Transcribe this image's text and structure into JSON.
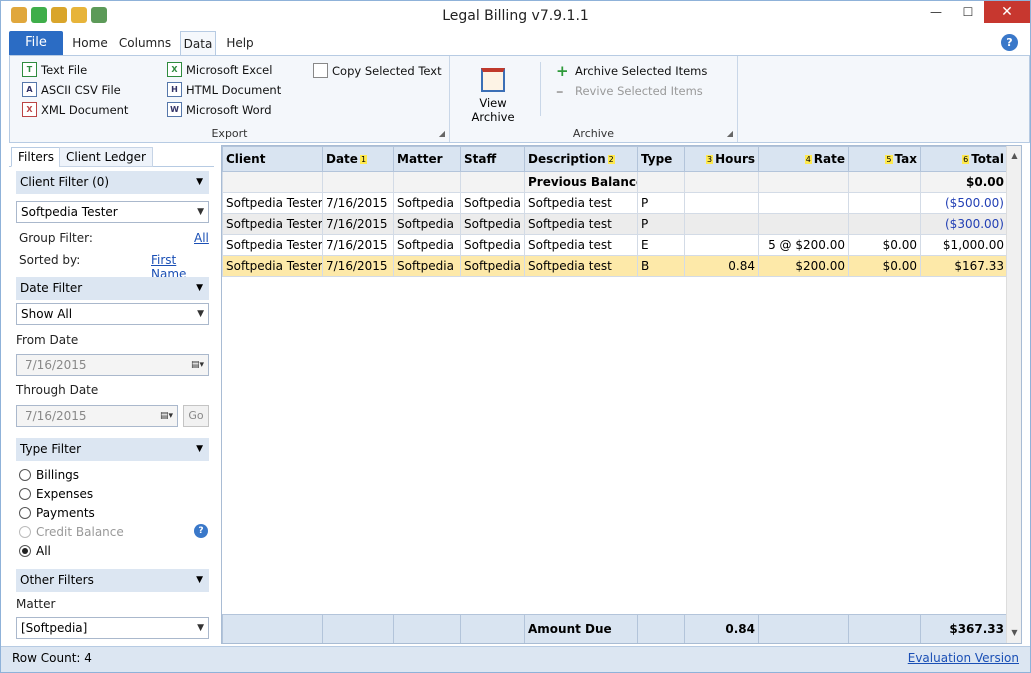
{
  "app": {
    "title": "Legal Billing v7.9.1.1"
  },
  "window": {
    "min": "—",
    "max": "☐",
    "close": "✕"
  },
  "tabs": [
    {
      "label": "File"
    },
    {
      "label": "Home"
    },
    {
      "label": "Columns"
    },
    {
      "label": "Data"
    },
    {
      "label": "Help"
    }
  ],
  "help_icon": "?",
  "ribbon": {
    "export": {
      "label": "Export",
      "text_file": "Text File",
      "ascii_csv": "ASCII CSV File",
      "xml_doc": "XML Document",
      "excel": "Microsoft Excel",
      "html_doc": "HTML Document",
      "word": "Microsoft Word",
      "copy_text": "Copy Selected Text"
    },
    "archive": {
      "label": "Archive",
      "view": "View Archive",
      "archive_items": "Archive Selected Items",
      "revive_items": "Revive Selected Items"
    }
  },
  "left": {
    "tab_filters": "Filters",
    "tab_ledger": "Client Ledger",
    "client_filter": "Client Filter (0)",
    "client_value": "Softpedia Tester",
    "group_filter_label": "Group Filter:",
    "group_filter_value": "All",
    "sorted_label": "Sorted by:",
    "sorted_value": "First Name",
    "date_filter": "Date Filter",
    "date_value": "Show All",
    "from_date_label": "From Date",
    "from_date": "7/16/2015",
    "through_date_label": "Through Date",
    "through_date": "7/16/2015",
    "go": "Go",
    "type_filter": "Type Filter",
    "types": [
      "Billings",
      "Expenses",
      "Payments",
      "Credit Balance",
      "All"
    ],
    "other_filters": "Other Filters",
    "matter_label": "Matter",
    "matter_value": "[Softpedia]"
  },
  "grid": {
    "columns": [
      {
        "label": "Client",
        "num": ""
      },
      {
        "label": "Date",
        "num": "1"
      },
      {
        "label": "Matter",
        "num": ""
      },
      {
        "label": "Staff",
        "num": ""
      },
      {
        "label": "Description",
        "num": "2"
      },
      {
        "label": "Type",
        "num": ""
      },
      {
        "label": "Hours",
        "num": "3"
      },
      {
        "label": "Rate",
        "num": "4"
      },
      {
        "label": "Tax",
        "num": "5"
      },
      {
        "label": "Total",
        "num": "6"
      }
    ],
    "prev_balance": {
      "label": "Previous Balance",
      "total": "$0.00"
    },
    "rows": [
      [
        "Softpedia Tester",
        "7/16/2015",
        "Softpedia",
        "Softpedia",
        "Softpedia test",
        "P",
        "",
        "",
        "",
        "($500.00)"
      ],
      [
        "Softpedia Tester",
        "7/16/2015",
        "Softpedia",
        "Softpedia",
        "Softpedia test",
        "P",
        "",
        "",
        "",
        "($300.00)"
      ],
      [
        "Softpedia Tester",
        "7/16/2015",
        "Softpedia",
        "Softpedia",
        "Softpedia test",
        "E",
        "",
        "5 @ $200.00",
        "$0.00",
        "$1,000.00"
      ],
      [
        "Softpedia Tester",
        "7/16/2015",
        "Softpedia",
        "Softpedia",
        "Softpedia test",
        "B",
        "0.84",
        "$200.00",
        "$0.00",
        "$167.33"
      ]
    ],
    "footer": {
      "label": "Amount Due",
      "hours": "0.84",
      "total": "$367.33"
    }
  },
  "status": {
    "row_count": "Row Count:  4",
    "evaluation": "Evaluation Version"
  }
}
